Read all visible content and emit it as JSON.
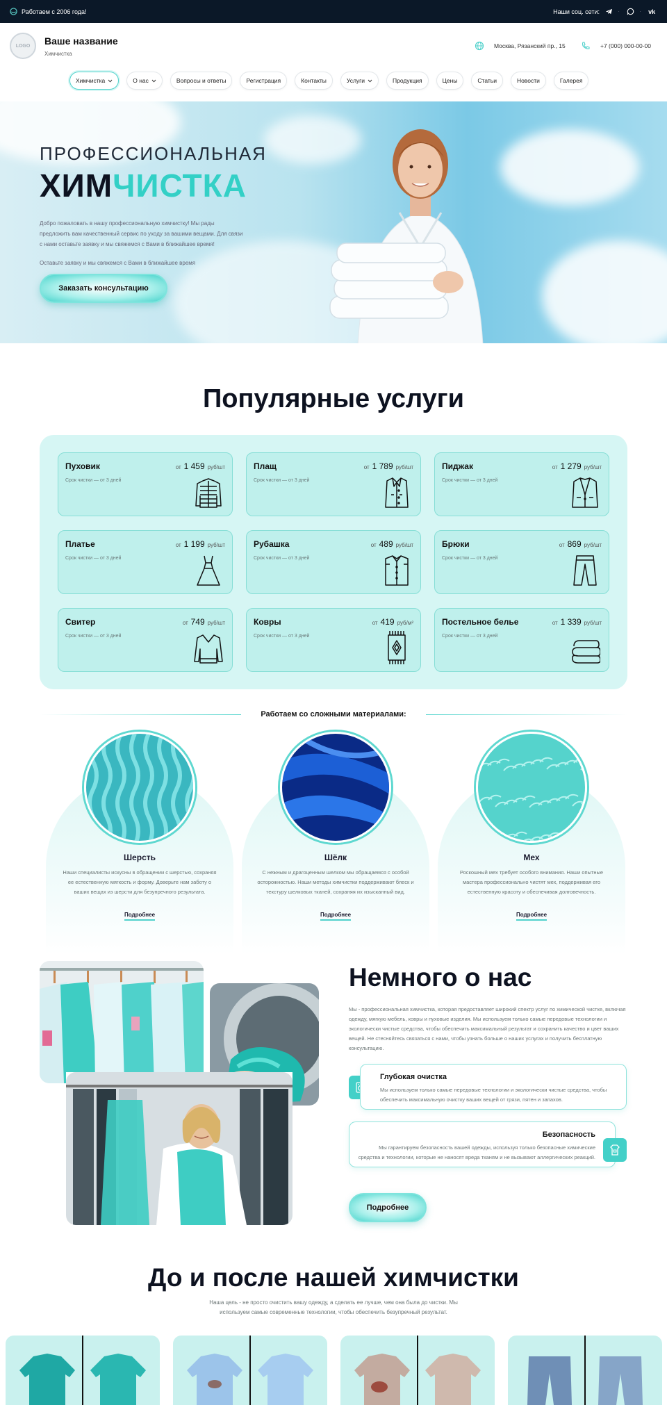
{
  "topbar": {
    "since": "Работаем с 2006 года!",
    "social_label": "Наши соц. сети:"
  },
  "header": {
    "logo": "LOGO",
    "brand_title": "Ваше название",
    "brand_subtitle": "Химчистка",
    "address": "Москва, Рязанский пр., 15",
    "phone": "+7 (000) 000-00-00"
  },
  "nav": [
    {
      "label": "Химчистка",
      "dropdown": true,
      "active": true
    },
    {
      "label": "О нас",
      "dropdown": true
    },
    {
      "label": "Вопросы и ответы"
    },
    {
      "label": "Регистрация"
    },
    {
      "label": "Контакты"
    },
    {
      "label": "Услуги",
      "dropdown": true
    },
    {
      "label": "Продукция"
    },
    {
      "label": "Цены"
    },
    {
      "label": "Статьи"
    },
    {
      "label": "Новости"
    },
    {
      "label": "Галерея"
    }
  ],
  "hero": {
    "title_line1": "ПРОФЕССИОНАЛЬНАЯ",
    "title_dark": "ХИМ",
    "title_accent": "ЧИСТКА",
    "description": "Добро пожаловать в нашу профессиональную химчистку! Мы рады предложить вам качественный сервис по уходу за вашими вещами. Для связи с нами оставьте заявку и мы свяжемся с Вами в ближайшее время!",
    "note": "Оставьте заявку и мы свяжемся с Вами в ближайшее время",
    "cta": "Заказать консультацию"
  },
  "services": {
    "title": "Популярные услуги",
    "from": "от",
    "term": "Срок чистки — от 3 дней",
    "items": [
      {
        "name": "Пуховик",
        "price": "1 459",
        "unit": "руб/шт",
        "icon": "puffer-jacket-icon"
      },
      {
        "name": "Плащ",
        "price": "1 789",
        "unit": "руб/шт",
        "icon": "coat-icon"
      },
      {
        "name": "Пиджак",
        "price": "1 279",
        "unit": "руб/шт",
        "icon": "blazer-icon"
      },
      {
        "name": "Платье",
        "price": "1 199",
        "unit": "руб/шт",
        "icon": "dress-icon"
      },
      {
        "name": "Рубашка",
        "price": "489",
        "unit": "руб/шт",
        "icon": "shirt-icon"
      },
      {
        "name": "Брюки",
        "price": "869",
        "unit": "руб/шт",
        "icon": "trousers-icon"
      },
      {
        "name": "Свитер",
        "price": "749",
        "unit": "руб/шт",
        "icon": "sweater-icon"
      },
      {
        "name": "Ковры",
        "price": "419",
        "unit": "руб/м²",
        "icon": "carpet-icon"
      },
      {
        "name": "Постельное белье",
        "price": "1 339",
        "unit": "руб/шт",
        "icon": "bedding-icon"
      }
    ]
  },
  "materials": {
    "title": "Работаем со сложными материалами:",
    "more": "Подробнее",
    "items": [
      {
        "name": "Шерсть",
        "text": "Наши специалисты искусны в обращении с шерстью, сохраняя ее естественную мягкость и форму. Доверьте нам заботу о ваших вещах из шерсти для безупречного результата."
      },
      {
        "name": "Шёлк",
        "text": "С нежным и драгоценным шелком мы обращаемся с особой осторожностью. Наши методы химчистки поддерживают блеск и текстуру шелковых тканей, сохраняя их изысканный вид."
      },
      {
        "name": "Мех",
        "text": "Роскошный мех требует особого внимания. Наши опытные мастера профессионально чистят мех, поддерживая его естественную красоту и обеспечивая долговечность."
      }
    ]
  },
  "about": {
    "title": "Немного о нас",
    "text": "Мы - профессиональная химчистка, которая предоставляет широкий спектр услуг по химической чистке, включая одежду, мягкую мебель, ковры и пуховые изделия. Мы используем только самые передовые технологии и экологически чистые средства, чтобы обеспечить максимальный результат и сохранить качество и цвет ваших вещей. Не стесняйтесь связаться с нами, чтобы узнать больше о наших услугах и получить бесплатную консультацию.",
    "feature1_title": "Глубокая очистка",
    "feature1_text": "Мы используем только самые передовые технологии и экологически чистые средства, чтобы обеспечить максимальную очистку ваших вещей от грязи, пятен и запахов.",
    "feature2_title": "Безопасность",
    "feature2_text": "Мы гарантируем безопасность вашей одежды, используя только безопасные химические средства и технологии, которые не наносят вреда тканям и не вызывают аллергических реакций.",
    "button": "Подробнее"
  },
  "before_after": {
    "title": "До и после нашей химчистки",
    "subtitle": "Наша цель - не просто очистить вашу одежду, а сделать ее лучше, чем она была до чистки. Мы используем самые современные технологии, чтобы обеспечить безупречный результат."
  },
  "colors": {
    "accent": "#33d0c6",
    "dark": "#0b1828",
    "card_bg": "#bff0ec",
    "section_bg": "#d6f6f4"
  }
}
